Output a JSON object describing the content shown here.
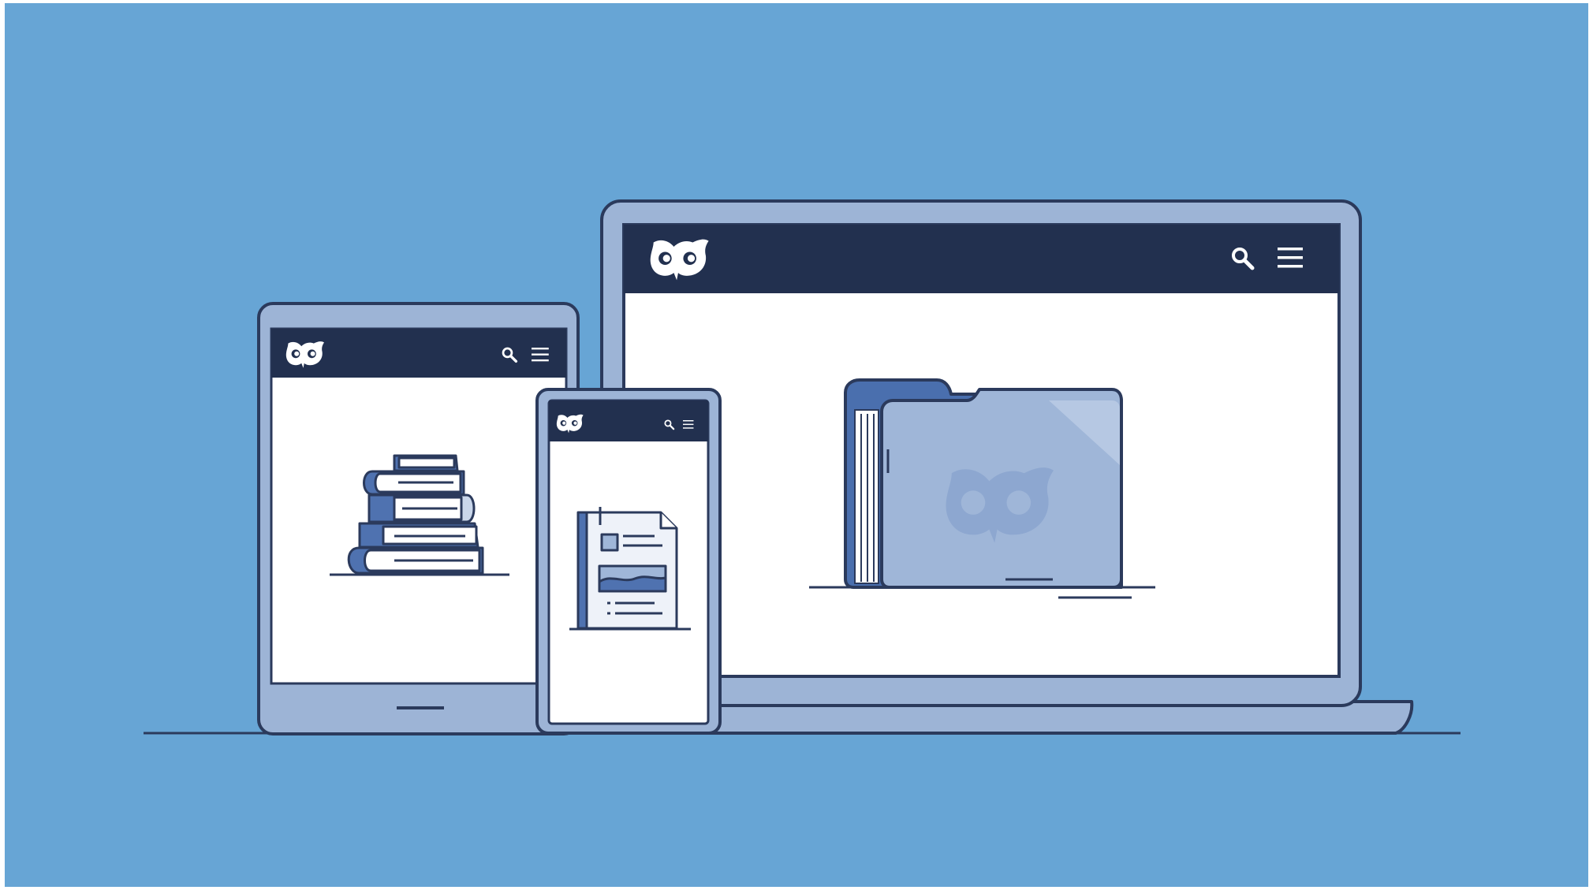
{
  "scene": {
    "description_label": "",
    "colors": {
      "background": "#67a5d5",
      "device_frame": "#9db4d6",
      "outline": "#2b3a5c",
      "header_navy": "#22304f",
      "screen": "#ffffff",
      "folder_body": "#9fb6d8",
      "folder_accent": "#4a6fae",
      "book_blue": "#4f72b0",
      "book_light": "#c9d6ea"
    }
  },
  "laptop": {
    "logo_icon": "owl-logo-icon",
    "search_icon": "search-icon",
    "menu_icon": "hamburger-menu-icon",
    "content_icon": "folder-icon"
  },
  "tablet": {
    "logo_icon": "owl-logo-icon",
    "search_icon": "search-icon",
    "menu_icon": "hamburger-menu-icon",
    "content_icon": "book-stack-icon"
  },
  "phone": {
    "logo_icon": "owl-logo-icon",
    "search_icon": "search-icon",
    "menu_icon": "hamburger-menu-icon",
    "content_icon": "document-icon"
  }
}
